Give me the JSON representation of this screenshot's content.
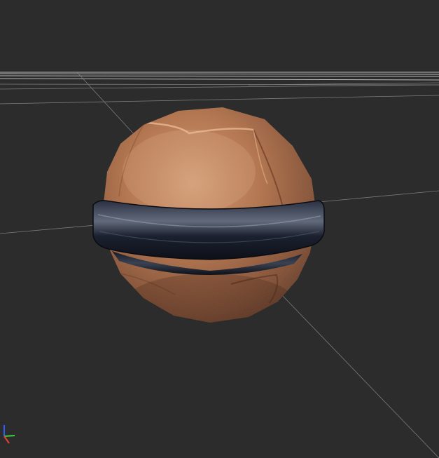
{
  "viewport": {
    "background_color": "#2c2c2c",
    "grid_color": "#8a8a8a",
    "grid_horizon_color": "#b8b8b8"
  },
  "model": {
    "icon": "textured-sphere-model",
    "base_color": "#b8774f",
    "highlight_color": "#d79a70",
    "shadow_color": "#5e3522",
    "band_color": "#1c2130",
    "band_highlight_color": "#7c8596"
  },
  "axis_gizmo": {
    "icon": "axis-gizmo-icon",
    "x_color": "#e8412f",
    "y_color": "#3cd23c",
    "z_color": "#2f5cff"
  }
}
